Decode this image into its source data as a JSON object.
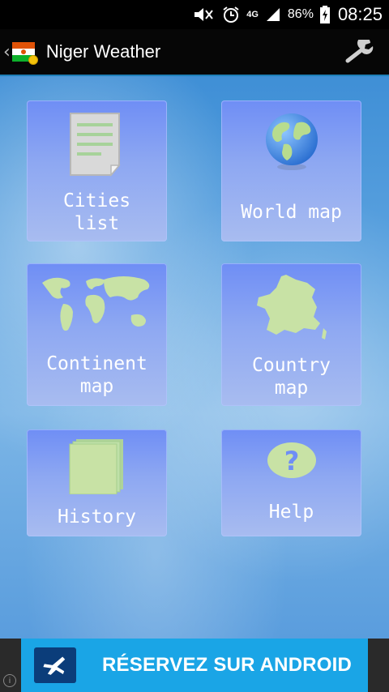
{
  "status_bar": {
    "network": "4G",
    "battery": "86%",
    "time": "08:25"
  },
  "app": {
    "title": "Niger Weather"
  },
  "tiles": [
    {
      "label": "Cities\nlist",
      "icon": "document-icon"
    },
    {
      "label": "World map",
      "icon": "globe-icon"
    },
    {
      "label": "Continent\nmap",
      "icon": "world-map-icon"
    },
    {
      "label": "Country\nmap",
      "icon": "country-map-icon"
    },
    {
      "label": "History",
      "icon": "stack-icon"
    },
    {
      "label": "Help",
      "icon": "help-icon"
    }
  ],
  "ad": {
    "text": "RÉSERVEZ SUR ANDROID",
    "info": "i"
  },
  "colors": {
    "tile_top": "#6f8ef5",
    "tile_bottom": "#a8bcf0",
    "ad_background": "#1aa5e6",
    "ad_logo": "#0b3d7a",
    "action_bar_divider": "#1e7fb8"
  }
}
